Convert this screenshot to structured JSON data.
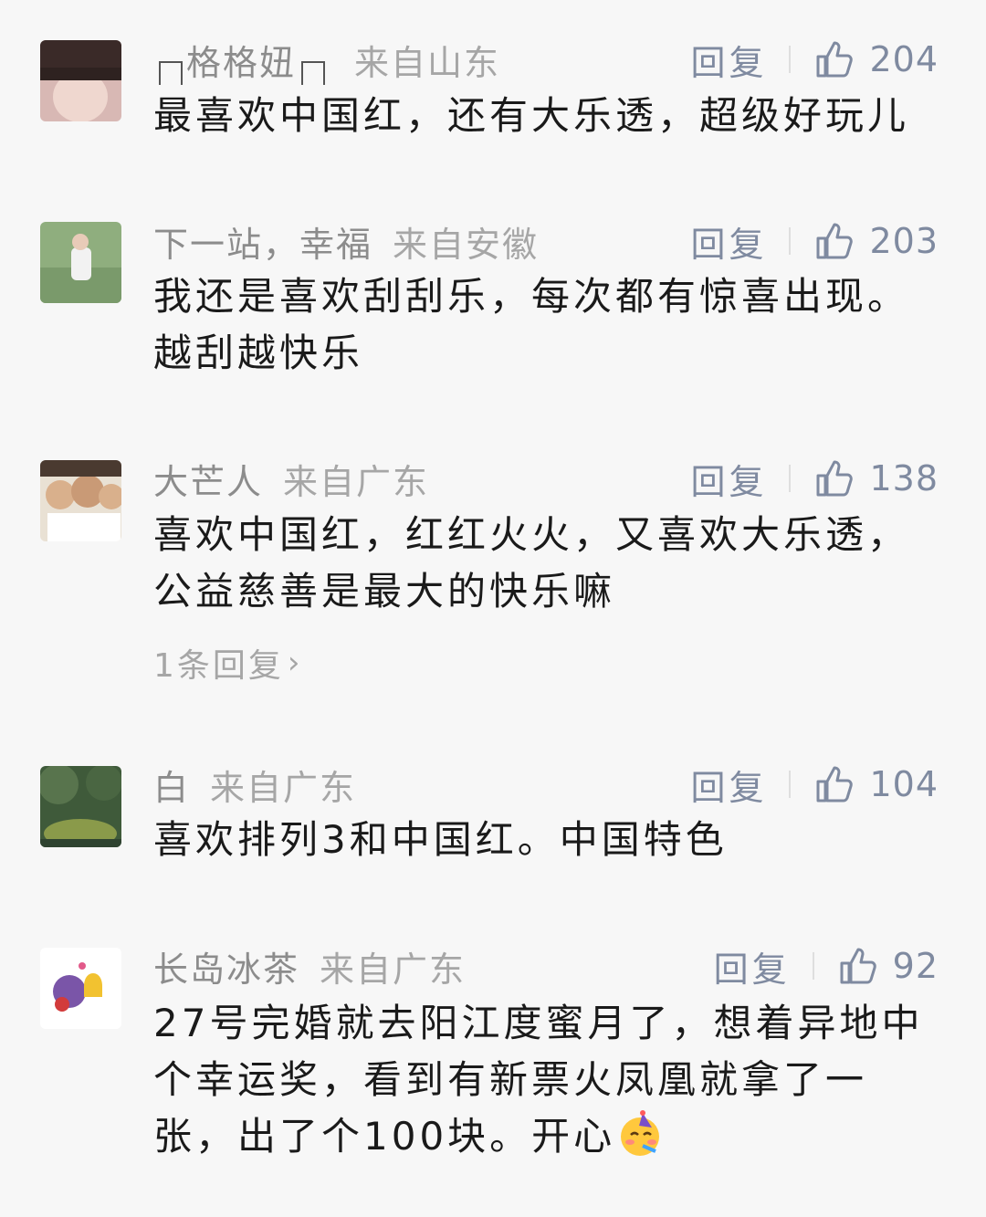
{
  "actions": {
    "reply_label": "回复"
  },
  "comments": [
    {
      "nickname": "格格妞",
      "location": "来自山东",
      "likes": "204",
      "text": "最喜欢中国红，还有大乐透，超级好玩儿"
    },
    {
      "nickname": "下一站，幸福",
      "location": "来自安徽",
      "likes": "203",
      "text": "我还是喜欢刮刮乐，每次都有惊喜出现。越刮越快乐"
    },
    {
      "nickname": "大芒人",
      "location": "来自广东",
      "likes": "138",
      "text": "喜欢中国红，红红火火，又喜欢大乐透，公益慈善是最大的快乐嘛",
      "replies_link": "1条回复"
    },
    {
      "nickname": "白",
      "location": "来自广东",
      "likes": "104",
      "text": "喜欢排列3和中国红。中国特色"
    },
    {
      "nickname": "长岛冰茶",
      "location": "来自广东",
      "likes": "92",
      "text": "27号完婚就去阳江度蜜月了，想着异地中个幸运奖，看到有新票火凤凰就拿了一张，出了个100块。开心"
    }
  ]
}
